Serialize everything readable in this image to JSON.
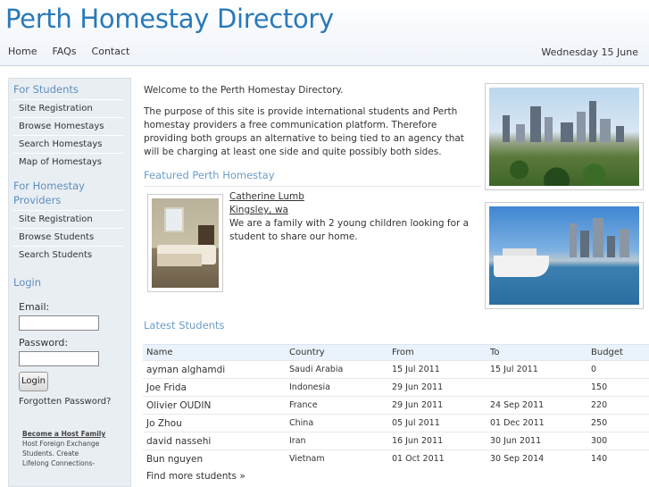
{
  "site": {
    "title": "Perth Homestay Directory",
    "date": "Wednesday 15 June"
  },
  "nav": [
    "Home",
    "FAQs",
    "Contact"
  ],
  "sidebar": {
    "students_heading": "For Students",
    "students_items": [
      "Site Registration",
      "Browse Homestays",
      "Search Homestays",
      "Map of Homestays"
    ],
    "providers_heading": "For Homestay Providers",
    "providers_items": [
      "Site Registration",
      "Browse Students",
      "Search Students"
    ],
    "login_heading": "Login",
    "email_label": "Email:",
    "password_label": "Password:",
    "login_button": "Login",
    "forgot_link": "Forgotten Password?",
    "promo_title": "Become a Host Family",
    "promo_text": "Host Foreign Exchange Students. Create Lifelong Connections-"
  },
  "intro": {
    "welcome": "Welcome to the Perth Homestay Directory.",
    "purpose": "The purpose of this site is provide international students and Perth homestay providers a free communication platform. Therefore providing both groups an alternative to being tied to an agency that will be charging at least one side and quite possibly both sides."
  },
  "featured": {
    "heading": "Featured Perth Homestay",
    "name": "Catherine Lumb",
    "location": "Kingsley, wa",
    "description": "We are a family with 2 young children looking for a student to share our home."
  },
  "latest": {
    "heading": "Latest Students",
    "columns": [
      "Name",
      "Country",
      "From",
      "To",
      "Budget"
    ],
    "rows": [
      [
        "ayman alghamdi",
        "Saudi Arabia",
        "15 Jul 2011",
        "15 Jul 2011",
        "0"
      ],
      [
        "Joe Frida",
        "Indonesia",
        "29 Jun 2011",
        "",
        "150"
      ],
      [
        "Olivier OUDIN",
        "France",
        "29 Jun 2011",
        "24 Sep 2011",
        "220"
      ],
      [
        "Jo Zhou",
        "China",
        "05 Jul 2011",
        "01 Dec 2011",
        "250"
      ],
      [
        "david nassehi",
        "Iran",
        "16 Jun 2011",
        "30 Jun 2011",
        "300"
      ],
      [
        "Bun nguyen",
        "Vietnam",
        "01 Oct 2011",
        "30 Sep 2014",
        "140"
      ]
    ],
    "more": "Find more students »"
  }
}
